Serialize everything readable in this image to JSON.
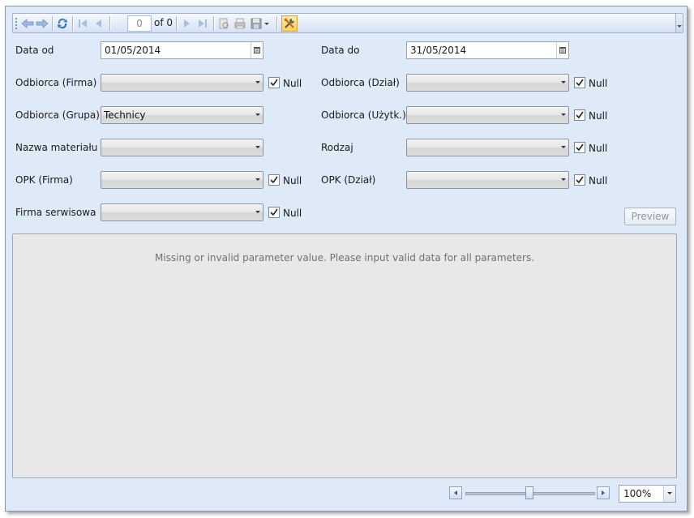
{
  "toolbar": {
    "page_value": "0",
    "of_label": "of 0",
    "icons": [
      "grip-icon",
      "back-icon",
      "forward-icon",
      "refresh-icon",
      "first-page-icon",
      "previous-page-icon",
      "next-page-icon",
      "last-page-icon",
      "print-layout-icon",
      "print-icon",
      "save-icon",
      "save-dropdown-icon",
      "tools-icon"
    ]
  },
  "params": {
    "data_od": {
      "label": "Data od",
      "value": "01/05/2014"
    },
    "data_do": {
      "label": "Data do",
      "value": "31/05/2014"
    },
    "odbiorca_firma": {
      "label": "Odbiorca (Firma)",
      "value": "",
      "null_label": "Null",
      "null_checked": true
    },
    "odbiorca_dzial": {
      "label": "Odbiorca (Dział)",
      "value": "",
      "null_label": "Null",
      "null_checked": true
    },
    "odbiorca_grupa": {
      "label": "Odbiorca (Grupa)",
      "value": "Technicy"
    },
    "odbiorca_uzytk": {
      "label": "Odbiorca (Użytk.)",
      "value": "",
      "null_label": "Null",
      "null_checked": true
    },
    "nazwa_materialu": {
      "label": "Nazwa materiału",
      "value": ""
    },
    "rodzaj": {
      "label": "Rodzaj",
      "value": "",
      "null_label": "Null",
      "null_checked": true
    },
    "opk_firma": {
      "label": "OPK (Firma)",
      "value": "",
      "null_label": "Null",
      "null_checked": true
    },
    "opk_dzial": {
      "label": "OPK (Dział)",
      "value": "",
      "null_label": "Null",
      "null_checked": true
    },
    "firma_serwisowa": {
      "label": "Firma serwisowa",
      "value": "",
      "null_label": "Null",
      "null_checked": true
    }
  },
  "preview_label": "Preview",
  "viewer_message": "Missing or invalid parameter value. Please input valid data for all parameters.",
  "zoom": {
    "value": "100%",
    "slider_fraction": 0.5
  },
  "colors": {
    "window_bg": "#dfeaf8",
    "viewer_bg": "#e8e8e8",
    "toolbar_border": "#9db4d6"
  }
}
